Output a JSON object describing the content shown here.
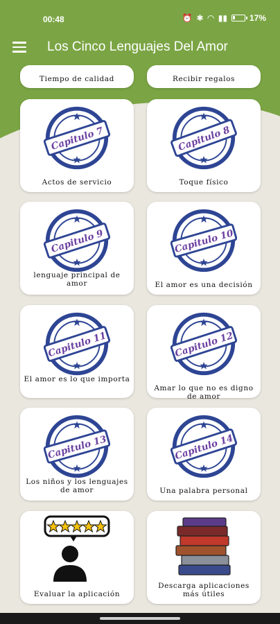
{
  "status": {
    "time": "00:48",
    "battery": "17%",
    "battery_level": 0.17
  },
  "app": {
    "title": "Los Cinco Lenguajes Del Amor"
  },
  "colors": {
    "header_green": "#7ba544",
    "stamp_blue": "#2e4594",
    "ribbon_purple": "#6b3fa0",
    "background": "#eae7df"
  },
  "top_partial": [
    {
      "label": "Tiempo de calidad"
    },
    {
      "label": "Recibir regalos"
    }
  ],
  "chapters": [
    {
      "stamp": "Capitulo 7",
      "label": "Actos de servicio"
    },
    {
      "stamp": "Capitulo 8",
      "label": "Toque físico"
    },
    {
      "stamp": "Capitulo 9",
      "label": "lenguaje principal de amor"
    },
    {
      "stamp": "Capitulo 10",
      "label": "El amor es una decisión"
    },
    {
      "stamp": "Capitulo 11",
      "label": "El amor es lo que importa"
    },
    {
      "stamp": "Capitulo 12",
      "label": "Amar lo que no es digno de amor"
    },
    {
      "stamp": "Capitulo 13",
      "label": "Los niños y los lenguajes de amor"
    },
    {
      "stamp": "Capitulo 14",
      "label": "Una palabra personal"
    }
  ],
  "actions": [
    {
      "label": "Evaluar la aplicación",
      "icon": "rate-app-icon"
    },
    {
      "label": "Descarga aplicaciones más útiles",
      "icon": "books-stack-icon"
    }
  ]
}
